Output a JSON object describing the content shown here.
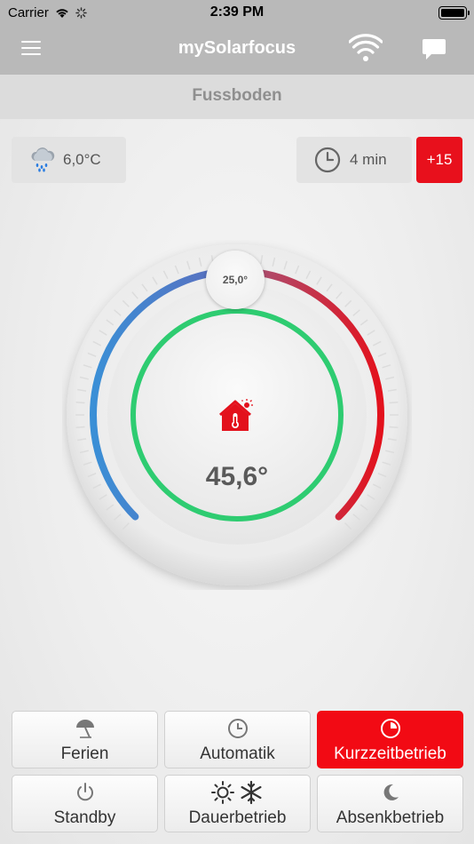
{
  "status": {
    "carrier": "Carrier",
    "time": "2:39 PM"
  },
  "nav": {
    "title": "mySolarfocus",
    "menu_icon": "hamburger-menu-icon",
    "wifi_icon": "wifi-icon",
    "chat_icon": "chat-bubble-icon"
  },
  "subheader": {
    "title": "Fussboden"
  },
  "weather": {
    "icon": "cloud-rain-icon",
    "temperature": "6,0°C"
  },
  "timer": {
    "icon": "clock-icon",
    "value": "4 min",
    "extend_label": "+15"
  },
  "dial": {
    "setpoint_label": "25,0°",
    "current_temperature": "45,6°",
    "center_icon": "house-thermometer-icon",
    "ring_color": "#2ecc71",
    "cold_color": "#3a8fd6",
    "hot_color": "#e3111c"
  },
  "modes": [
    {
      "label": "Ferien",
      "icon": "umbrella-icon",
      "active": false
    },
    {
      "label": "Automatik",
      "icon": "clock-icon",
      "active": false
    },
    {
      "label": "Kurzzeitbetrieb",
      "icon": "timer-icon",
      "active": true
    },
    {
      "label": "Standby",
      "icon": "power-icon",
      "active": false
    },
    {
      "label": "Dauerbetrieb",
      "icon": "sun-snowflake-icon",
      "active": false
    },
    {
      "label": "Absenkbetrieb",
      "icon": "moon-icon",
      "active": false
    }
  ],
  "colors": {
    "accent_red": "#f20a14",
    "nav_bg": "#b9b9b9"
  }
}
